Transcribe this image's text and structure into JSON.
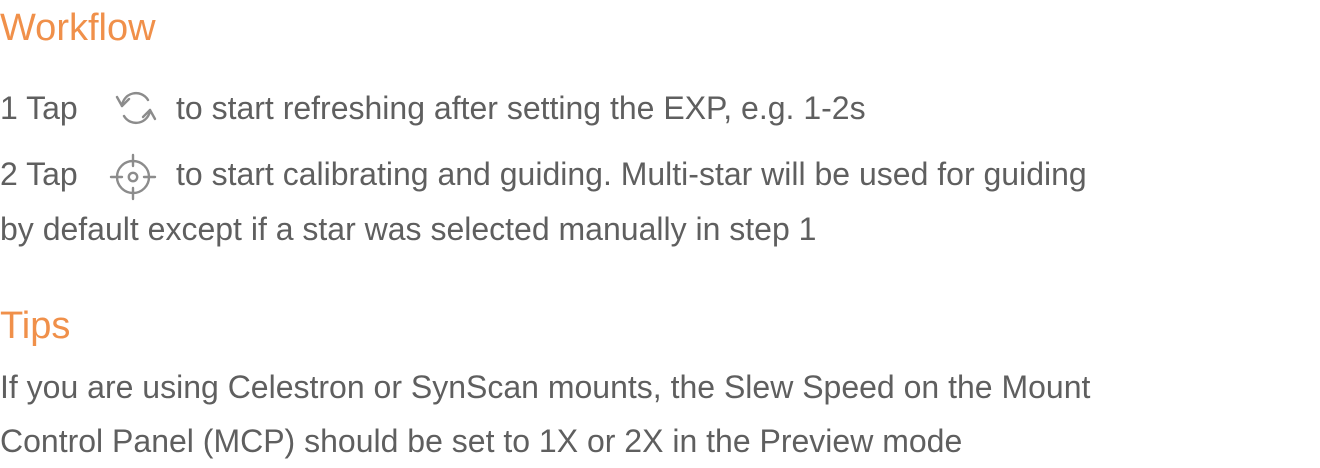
{
  "workflow": {
    "heading": "Workflow",
    "step1": {
      "prefix": "1 Tap",
      "icon": "refresh-icon",
      "text": "to start refreshing after setting the EXP, e.g. 1-2s"
    },
    "step2": {
      "prefix": "2 Tap",
      "icon": "target-icon",
      "text": "to start calibrating and guiding. Multi-star will be used for guiding",
      "continuation": "by default except if a star was selected manually in step 1"
    }
  },
  "tips": {
    "heading": "Tips",
    "line1": "If you are using Celestron or SynScan mounts, the Slew Speed on the Mount",
    "line2": "Control Panel (MCP) should be set to 1X or 2X in the Preview mode"
  },
  "colors": {
    "accent": "#f0904a",
    "text": "#5f5f5f",
    "icon": "#8c8c8c"
  }
}
